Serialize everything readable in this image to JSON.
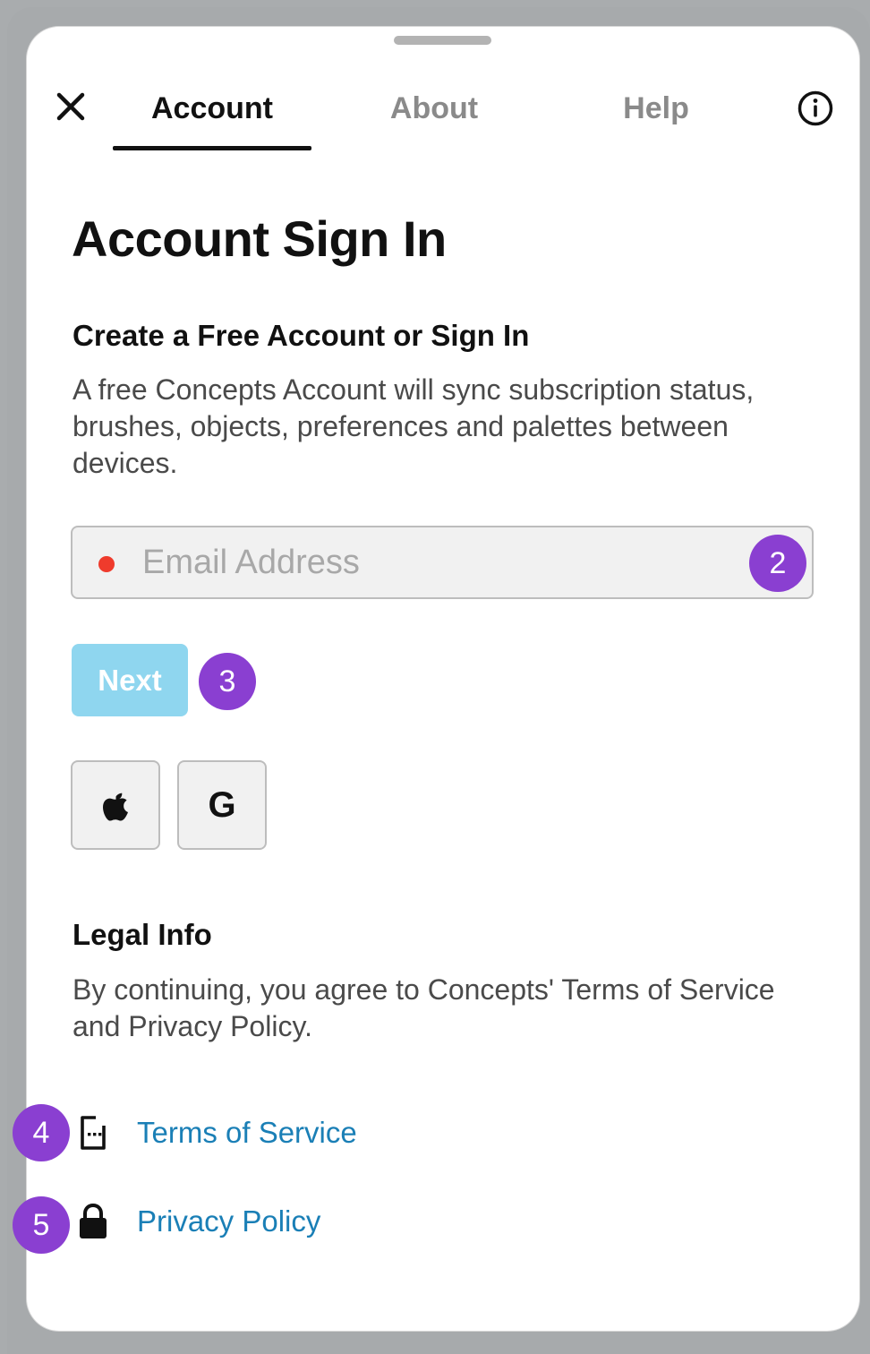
{
  "tabs": {
    "account": "Account",
    "about": "About",
    "help": "Help"
  },
  "icons": {
    "close": "close-icon",
    "info": "info-icon",
    "apple": "apple-icon",
    "google": "google-icon",
    "document": "document-icon",
    "lock": "lock-icon"
  },
  "page": {
    "title": "Account Sign In"
  },
  "signin": {
    "heading": "Create a Free Account or Sign In",
    "description": "A free Concepts Account will sync subscription status, brushes, objects, preferences and palettes between devices.",
    "email_placeholder": "Email Address",
    "email_value": "",
    "next_label": "Next",
    "google_letter": "G"
  },
  "legal": {
    "heading": "Legal Info",
    "description": "By continuing, you agree to Concepts' Terms of Service and Privacy Policy.",
    "terms_label": "Terms of Service",
    "privacy_label": "Privacy Policy"
  },
  "badges": {
    "email": "2",
    "next": "3",
    "terms": "4",
    "privacy": "5"
  },
  "colors": {
    "accent_link": "#1a7fb6",
    "next_button": "#8fd6ef",
    "badge": "#8a3fd1",
    "required_dot": "#ef3b2c"
  }
}
